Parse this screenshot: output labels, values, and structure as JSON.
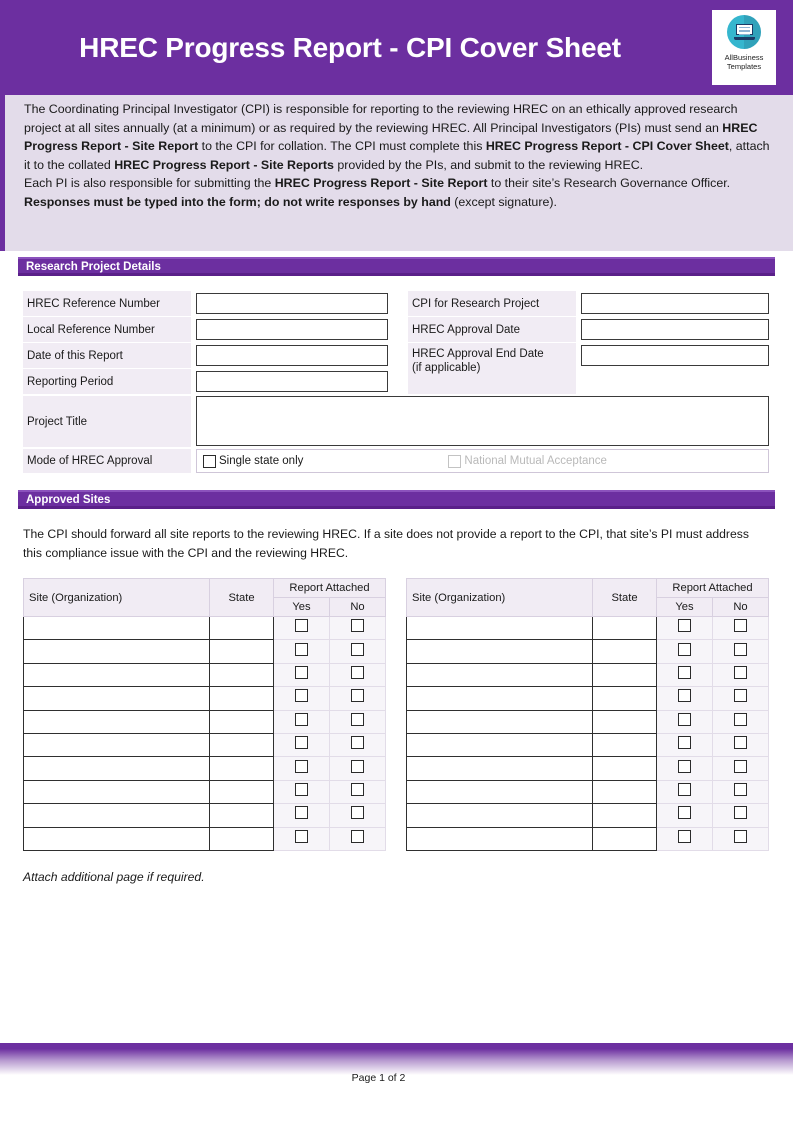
{
  "header": {
    "title": "HREC Progress Report - CPI Cover Sheet",
    "brand_line1": "AllBusiness",
    "brand_line2": "Templates",
    "accent_color": "#6C2FA0",
    "logo_color": "#35B6CE"
  },
  "intro": {
    "para1_a": "The Coordinating Principal Investigator (CPI) is responsible for reporting to the reviewing HREC on an ethically approved research project at all sites annually (at a minimum) or as required by the reviewing HREC.  All Principal Investigators (PIs) must send an ",
    "para1_b": "HREC Progress Report - Site Report",
    "para1_c": " to the CPI for collation.  The CPI must complete this ",
    "para1_d": "HREC Progress Report - CPI Cover Sheet",
    "para1_e": ", attach it to the collated ",
    "para1_f": "HREC Progress Report - Site Reports",
    "para1_g": " provided by the PIs, and submit to the reviewing HREC.",
    "para2_a": "Each PI is also responsible for submitting the ",
    "para2_b": "HREC Progress Report - Site Report",
    "para2_c": " to their site’s Research Governance Officer.",
    "para3_a": "Responses must be typed into the form; do not write responses by hand",
    "para3_b": " (except signature)."
  },
  "sections": {
    "research_details": "Research Project Details",
    "approved_sites": "Approved Sites"
  },
  "details": {
    "left_labels": [
      "HREC Reference Number",
      "Local Reference Number",
      "Date of this Report",
      "Reporting Period"
    ],
    "right_labels": [
      "CPI for Research Project",
      "HREC Approval Date",
      "HREC Approval End Date"
    ],
    "right_label_3_sub": "(if applicable)",
    "project_title_label": "Project Title",
    "mode_label": "Mode of HREC Approval",
    "mode_options": [
      {
        "label": "Single state only",
        "checked": false,
        "disabled": false
      },
      {
        "label": "National Mutual Acceptance",
        "checked": false,
        "disabled": true
      }
    ],
    "values": {
      "hrec_reference_number": "",
      "local_reference_number": "",
      "date_of_this_report": "",
      "reporting_period": "",
      "cpi_for_research_project": "",
      "hrec_approval_date": "",
      "hrec_approval_end_date": "",
      "project_title": ""
    }
  },
  "sites": {
    "intro": "The CPI should forward all site reports to the reviewing HREC.  If a site does not provide a report to the CPI, that site’s PI must address this compliance issue with the CPI and the reviewing HREC.",
    "headers": {
      "site": "Site (Organization)",
      "state": "State",
      "report_attached": "Report Attached",
      "yes": "Yes",
      "no": "No"
    },
    "row_count": 10,
    "rows_left": [
      {
        "site": "",
        "state": "",
        "yes": false,
        "no": false
      },
      {
        "site": "",
        "state": "",
        "yes": false,
        "no": false
      },
      {
        "site": "",
        "state": "",
        "yes": false,
        "no": false
      },
      {
        "site": "",
        "state": "",
        "yes": false,
        "no": false
      },
      {
        "site": "",
        "state": "",
        "yes": false,
        "no": false
      },
      {
        "site": "",
        "state": "",
        "yes": false,
        "no": false
      },
      {
        "site": "",
        "state": "",
        "yes": false,
        "no": false
      },
      {
        "site": "",
        "state": "",
        "yes": false,
        "no": false
      },
      {
        "site": "",
        "state": "",
        "yes": false,
        "no": false
      },
      {
        "site": "",
        "state": "",
        "yes": false,
        "no": false
      }
    ],
    "rows_right": [
      {
        "site": "",
        "state": "",
        "yes": false,
        "no": false
      },
      {
        "site": "",
        "state": "",
        "yes": false,
        "no": false
      },
      {
        "site": "",
        "state": "",
        "yes": false,
        "no": false
      },
      {
        "site": "",
        "state": "",
        "yes": false,
        "no": false
      },
      {
        "site": "",
        "state": "",
        "yes": false,
        "no": false
      },
      {
        "site": "",
        "state": "",
        "yes": false,
        "no": false
      },
      {
        "site": "",
        "state": "",
        "yes": false,
        "no": false
      },
      {
        "site": "",
        "state": "",
        "yes": false,
        "no": false
      },
      {
        "site": "",
        "state": "",
        "yes": false,
        "no": false
      },
      {
        "site": "",
        "state": "",
        "yes": false,
        "no": false
      }
    ],
    "attach_note": "Attach additional page if required."
  },
  "footer": {
    "page_label": "Page 1 of 2"
  }
}
